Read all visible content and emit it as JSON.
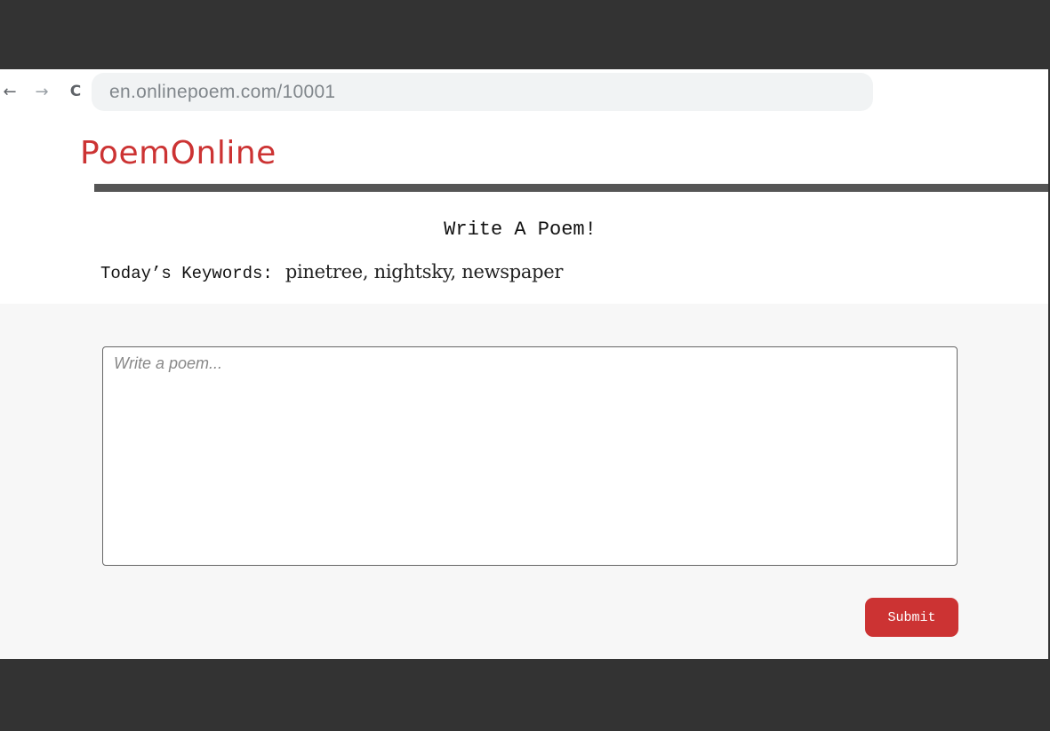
{
  "browser": {
    "back_icon": "arrow-left-icon",
    "forward_icon": "arrow-right-icon",
    "reload_icon": "reload-icon",
    "url": "en.onlinepoem.com/10001"
  },
  "header": {
    "brand": "PoemOnline"
  },
  "main": {
    "heading": "Write A Poem!",
    "keywords_label": "Today’s Keywords:",
    "keywords_value": "pinetree, nightsky, newspaper",
    "poem_placeholder": "Write a poem...",
    "submit_label": "Submit"
  },
  "colors": {
    "brand": "#cc3333",
    "rule": "#555555",
    "submit_bg": "#cc3333"
  }
}
